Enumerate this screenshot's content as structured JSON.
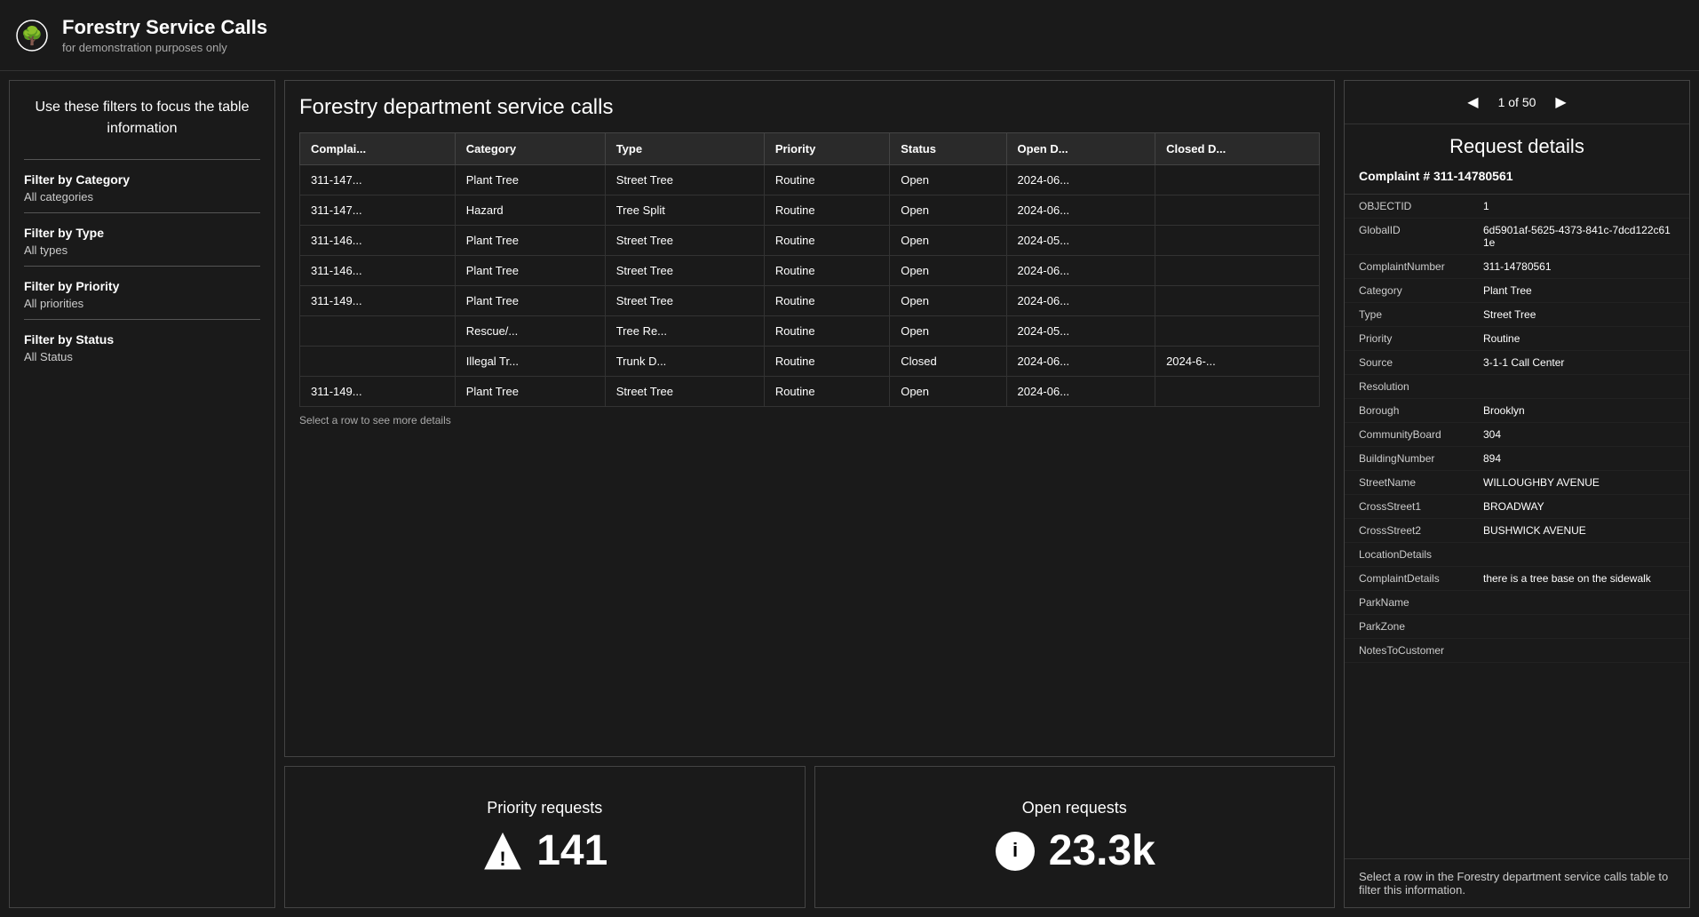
{
  "header": {
    "title": "Forestry Service Calls",
    "subtitle": "for demonstration purposes only",
    "icon": "🌳"
  },
  "leftPanel": {
    "intro": "Use these filters to focus the table information",
    "filters": [
      {
        "label": "Filter by Category",
        "value": "All categories"
      },
      {
        "label": "Filter by Type",
        "value": "All types"
      },
      {
        "label": "Filter by Priority",
        "value": "All priorities"
      },
      {
        "label": "Filter by Status",
        "value": "All Status"
      }
    ]
  },
  "tableSection": {
    "title": "Forestry department service calls",
    "columns": [
      "Complai...",
      "Category",
      "Type",
      "Priority",
      "Status",
      "Open D...",
      "Closed D..."
    ],
    "rows": [
      {
        "complaint": "311-147...",
        "category": "Plant Tree",
        "type": "Street Tree",
        "priority": "Routine",
        "status": "Open",
        "openDate": "2024-06...",
        "closedDate": ""
      },
      {
        "complaint": "311-147...",
        "category": "Hazard",
        "type": "Tree Split",
        "priority": "Routine",
        "status": "Open",
        "openDate": "2024-06...",
        "closedDate": ""
      },
      {
        "complaint": "311-146...",
        "category": "Plant Tree",
        "type": "Street Tree",
        "priority": "Routine",
        "status": "Open",
        "openDate": "2024-05...",
        "closedDate": ""
      },
      {
        "complaint": "311-146...",
        "category": "Plant Tree",
        "type": "Street Tree",
        "priority": "Routine",
        "status": "Open",
        "openDate": "2024-06...",
        "closedDate": ""
      },
      {
        "complaint": "311-149...",
        "category": "Plant Tree",
        "type": "Street Tree",
        "priority": "Routine",
        "status": "Open",
        "openDate": "2024-06...",
        "closedDate": ""
      },
      {
        "complaint": "",
        "category": "Rescue/...",
        "type": "Tree Re...",
        "priority": "Routine",
        "status": "Open",
        "openDate": "2024-05...",
        "closedDate": ""
      },
      {
        "complaint": "",
        "category": "Illegal Tr...",
        "type": "Trunk D...",
        "priority": "Routine",
        "status": "Closed",
        "openDate": "2024-06...",
        "closedDate": "2024-6-..."
      },
      {
        "complaint": "311-149...",
        "category": "Plant Tree",
        "type": "Street Tree",
        "priority": "Routine",
        "status": "Open",
        "openDate": "2024-06...",
        "closedDate": ""
      }
    ],
    "hint": "Select a row to see more details"
  },
  "statsCards": [
    {
      "title": "Priority requests",
      "value": "141",
      "iconType": "warning"
    },
    {
      "title": "Open requests",
      "value": "23.3k",
      "iconType": "info"
    }
  ],
  "rightPanel": {
    "navLabel": "1 of 50",
    "title": "Request details",
    "complaintNumber": "Complaint # 311-14780561",
    "details": [
      {
        "key": "OBJECTID",
        "val": "1"
      },
      {
        "key": "GlobalID",
        "val": "6d5901af-5625-4373-841c-7dcd122c611e"
      },
      {
        "key": "ComplaintNumber",
        "val": "311-14780561"
      },
      {
        "key": "Category",
        "val": "Plant Tree"
      },
      {
        "key": "Type",
        "val": "Street Tree"
      },
      {
        "key": "Priority",
        "val": "Routine"
      },
      {
        "key": "Source",
        "val": "3-1-1 Call Center"
      },
      {
        "key": "Resolution",
        "val": ""
      },
      {
        "key": "Borough",
        "val": "Brooklyn"
      },
      {
        "key": "CommunityBoard",
        "val": "304"
      },
      {
        "key": "BuildingNumber",
        "val": "894"
      },
      {
        "key": "StreetName",
        "val": "WILLOUGHBY AVENUE"
      },
      {
        "key": "CrossStreet1",
        "val": "BROADWAY"
      },
      {
        "key": "CrossStreet2",
        "val": "BUSHWICK AVENUE"
      },
      {
        "key": "LocationDetails",
        "val": ""
      },
      {
        "key": "ComplaintDetails",
        "val": "there is a tree base on the sidewalk"
      },
      {
        "key": "ParkName",
        "val": ""
      },
      {
        "key": "ParkZone",
        "val": ""
      },
      {
        "key": "NotesToCustomer",
        "val": ""
      }
    ],
    "footer": "Select a row in the Forestry department service calls table to filter this information."
  }
}
